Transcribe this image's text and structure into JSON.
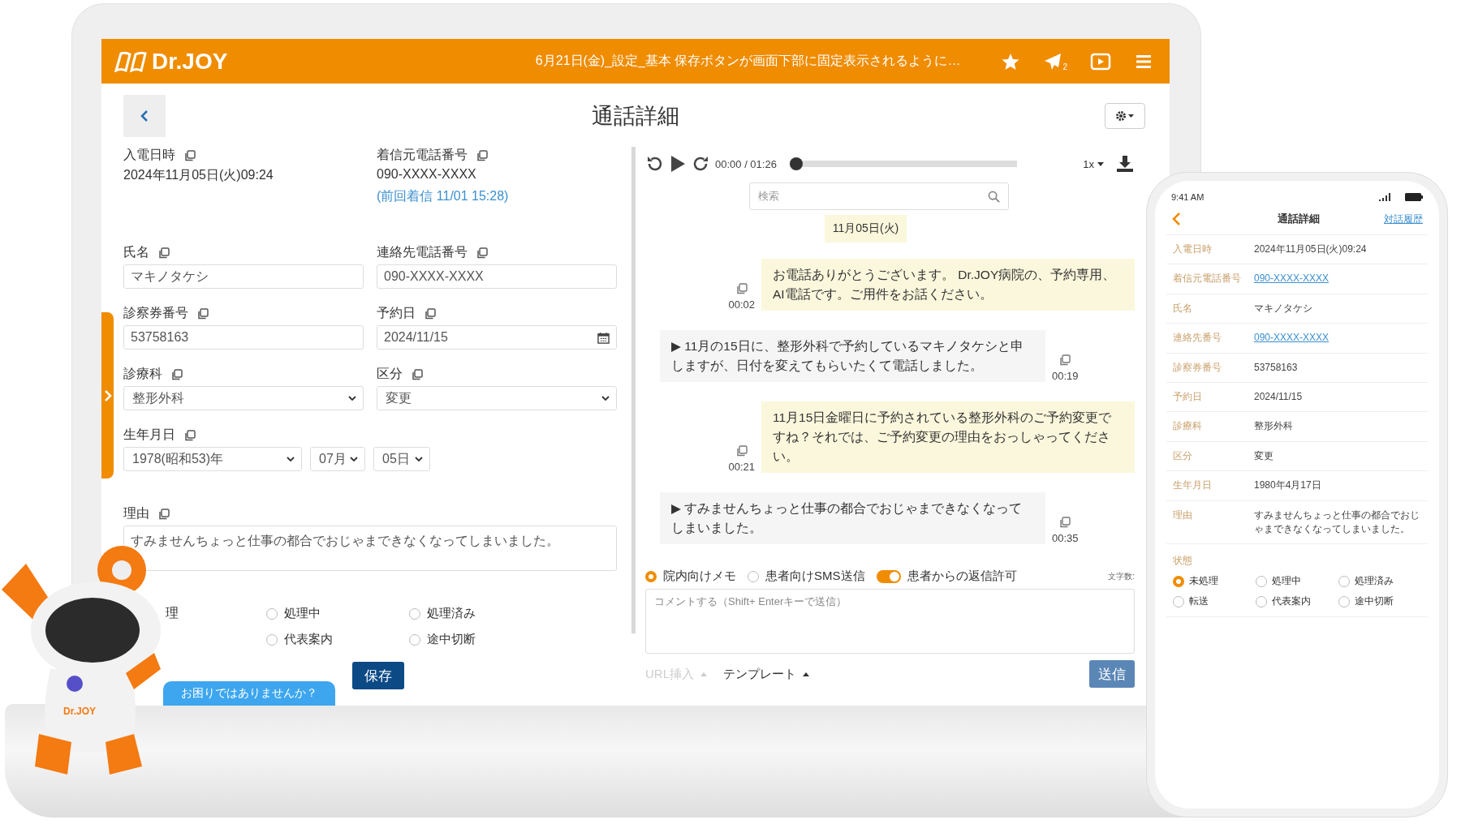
{
  "header": {
    "logo": "Dr.JOY",
    "notice": "6月21日(金)_設定_基本 保存ボタンが画面下部に固定表示されるように…",
    "plane_badge": "2"
  },
  "page": {
    "title": "通話詳細"
  },
  "form": {
    "fields": [
      {
        "kind": "static",
        "label": "入電日時",
        "value": "2024年11月05日(火)09:24"
      },
      {
        "kind": "static",
        "label": "着信元電話番号",
        "value": "090-XXXX-XXXX",
        "note": "(前回着信 11/01 15:28)"
      },
      {
        "kind": "input",
        "label": "氏名",
        "value": "マキノタケシ"
      },
      {
        "kind": "input",
        "label": "連絡先電話番号",
        "value": "090-XXXX-XXXX"
      },
      {
        "kind": "input",
        "label": "診察券番号",
        "value": "53758163"
      },
      {
        "kind": "date",
        "label": "予約日",
        "value": "2024/11/15"
      },
      {
        "kind": "select",
        "label": "診療科",
        "value": "整形外科"
      },
      {
        "kind": "select",
        "label": "区分",
        "value": "変更"
      },
      {
        "kind": "selects",
        "label": "生年月日",
        "values": [
          "1978(昭和53)年",
          "07月",
          "05日"
        ]
      },
      {
        "kind": "textarea",
        "label": "理由",
        "value": "すみませんちょっと仕事の都合でおじゃまできなくなってしまいました。"
      }
    ],
    "status_rows": [
      [
        {
          "kind": "partial",
          "label": "理"
        },
        {
          "kind": "radio",
          "label": "処理中",
          "selected": false
        },
        {
          "kind": "radio",
          "label": "処理済み",
          "selected": false
        }
      ],
      [
        {
          "kind": "radio",
          "label": "代表案内",
          "selected": false
        },
        {
          "kind": "radio",
          "label": "途中切断",
          "selected": false
        }
      ]
    ],
    "save": "保存"
  },
  "player": {
    "time": "00:00 / 01:26",
    "level": 0,
    "speed": "1x"
  },
  "search": {
    "placeholder": "検索"
  },
  "date_chip": "11月05日(火)",
  "messages": [
    {
      "kind": "bot",
      "text": "お電話ありがとうございます。 Dr.JOY病院の、予約専用、AI電話です。ご用件をお話ください。",
      "time": "00:02"
    },
    {
      "kind": "caller",
      "text": "▶ 11月の15日に、整形外科で予約しているマキノタケシと申しますが、日付を変えてもらいたくて電話しました。",
      "time": "00:19"
    },
    {
      "kind": "bot",
      "text": "11月15日金曜日に予約されている整形外科のご予約変更ですね？それでは、ご予約変更の理由をおっしゃってください。",
      "time": "00:21"
    },
    {
      "kind": "caller",
      "text": "▶ すみませんちょっと仕事の都合でおじゃまできなくなってしまいました。",
      "time": "00:35"
    }
  ],
  "composer": {
    "modes": [
      {
        "label": "院内向けメモ",
        "selected": true
      },
      {
        "label": "患者向けSMS送信",
        "selected": false
      }
    ],
    "reply_toggle": {
      "label": "患者からの返信許可",
      "on": true
    },
    "char_count": "文字数:",
    "placeholder": "コメントする（Shift+ Enterキーで送信）",
    "url_insert": {
      "label": "URL挿入",
      "disabled": true
    },
    "template": "テンプレート",
    "send": "送信"
  },
  "help": {
    "text": "お困りではありませんか？"
  },
  "mascot": {
    "label": "Dr.JOY"
  },
  "phone": {
    "time": "9:41 AM",
    "title": "通話詳細",
    "link": "対話履歴",
    "rows": [
      {
        "label": "入電日時",
        "value": "2024年11月05日(火)09:24",
        "link": false
      },
      {
        "label": "着信元電話番号",
        "value": "090-XXXX-XXXX",
        "link": true
      },
      {
        "label": "氏名",
        "value": "マキノタケシ",
        "link": false
      },
      {
        "label": "連絡先番号",
        "value": "090-XXXX-XXXX",
        "link": true
      },
      {
        "label": "診察券番号",
        "value": "53758163",
        "link": false
      },
      {
        "label": "予約日",
        "value": "2024/11/15",
        "link": false
      },
      {
        "label": "診療科",
        "value": "整形外科",
        "link": false
      },
      {
        "label": "区分",
        "value": "変更",
        "link": false
      },
      {
        "label": "生年月日",
        "value": "1980年4月17日",
        "link": false
      },
      {
        "label": "理由",
        "value": "すみませんちょっと仕事の都合でおじゃまできなくなってしまいました。",
        "link": false
      }
    ],
    "status_label": "状態",
    "status_options": [
      {
        "label": "未処理",
        "selected": true
      },
      {
        "label": "処理中",
        "selected": false
      },
      {
        "label": "処理済み",
        "selected": false
      },
      {
        "label": "転送",
        "selected": false
      },
      {
        "label": "代表案内",
        "selected": false
      },
      {
        "label": "途中切断",
        "selected": false
      }
    ]
  }
}
